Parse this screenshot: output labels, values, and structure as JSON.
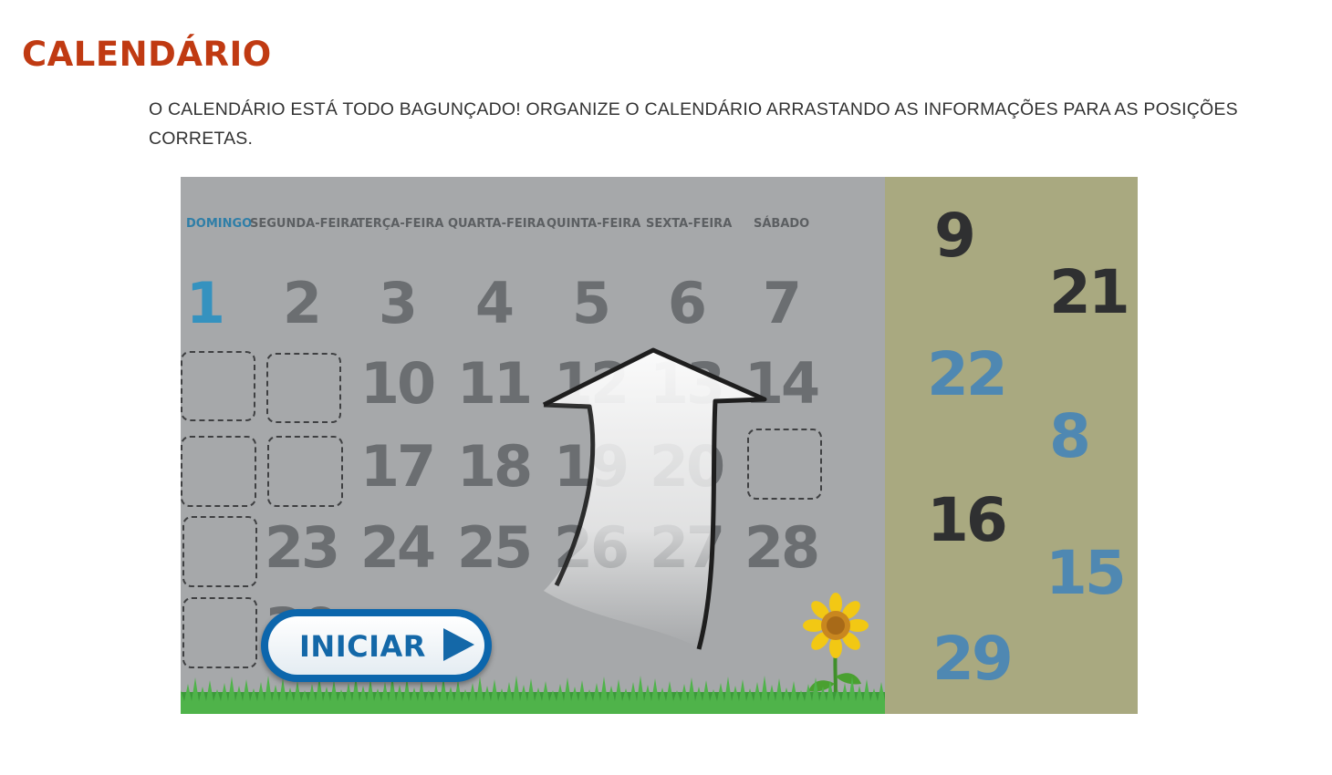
{
  "page": {
    "title": "CALENDÁRIO",
    "instructions": "O CALENDÁRIO ESTÁ TODO BAGUNÇADO! ORGANIZE O CALENDÁRIO ARRASTANDO AS INFORMAÇÕES PARA AS POSIÇÕES CORRETAS."
  },
  "game": {
    "weekdays": [
      "DOMINGO",
      "SEGUNDA-FEIRA",
      "TERÇA-FEIRA",
      "QUARTA-FEIRA",
      "QUINTA-FEIRA",
      "SEXTA-FEIRA",
      "SÁBADO"
    ],
    "board_numbers": [
      {
        "label": "1",
        "row": 0,
        "col": 0
      },
      {
        "label": "2",
        "row": 0,
        "col": 1
      },
      {
        "label": "3",
        "row": 0,
        "col": 2
      },
      {
        "label": "4",
        "row": 0,
        "col": 3
      },
      {
        "label": "5",
        "row": 0,
        "col": 4
      },
      {
        "label": "6",
        "row": 0,
        "col": 5
      },
      {
        "label": "7",
        "row": 0,
        "col": 6
      },
      {
        "label": "10",
        "row": 1,
        "col": 2
      },
      {
        "label": "11",
        "row": 1,
        "col": 3
      },
      {
        "label": "12",
        "row": 1,
        "col": 4
      },
      {
        "label": "13",
        "row": 1,
        "col": 5
      },
      {
        "label": "14",
        "row": 1,
        "col": 6
      },
      {
        "label": "17",
        "row": 2,
        "col": 2
      },
      {
        "label": "18",
        "row": 2,
        "col": 3
      },
      {
        "label": "19",
        "row": 2,
        "col": 4
      },
      {
        "label": "20",
        "row": 2,
        "col": 5
      },
      {
        "label": "23",
        "row": 3,
        "col": 1
      },
      {
        "label": "24",
        "row": 3,
        "col": 2
      },
      {
        "label": "25",
        "row": 3,
        "col": 3
      },
      {
        "label": "26",
        "row": 3,
        "col": 4
      },
      {
        "label": "27",
        "row": 3,
        "col": 5
      },
      {
        "label": "28",
        "row": 3,
        "col": 6
      },
      {
        "label": "30",
        "row": 4,
        "col": 1
      }
    ],
    "empty_slots": [
      {
        "row": 1,
        "col": 0
      },
      {
        "row": 1,
        "col": 1
      },
      {
        "row": 2,
        "col": 0
      },
      {
        "row": 2,
        "col": 1
      },
      {
        "row": 2,
        "col": 6
      },
      {
        "row": 3,
        "col": 0
      },
      {
        "row": 4,
        "col": 0
      }
    ],
    "tray_tiles": [
      {
        "label": "9",
        "color": "dark"
      },
      {
        "label": "21",
        "color": "dark"
      },
      {
        "label": "22",
        "color": "blue"
      },
      {
        "label": "8",
        "color": "blue"
      },
      {
        "label": "16",
        "color": "dark"
      },
      {
        "label": "15",
        "color": "blue"
      },
      {
        "label": "29",
        "color": "blue"
      }
    ],
    "start_button": {
      "label": "INICIAR",
      "icon": "play-icon"
    },
    "colors": {
      "title": "#c03a12",
      "board": "#a6a8aa",
      "tray": "#a9a980",
      "sunday": "#3592bf",
      "tile_blue": "#4f88b2",
      "tile_dark": "#2f3031",
      "button": "#1468a8"
    },
    "icons": [
      "up-arrow-icon",
      "sunflower-icon",
      "grass-icon",
      "play-icon"
    ]
  }
}
